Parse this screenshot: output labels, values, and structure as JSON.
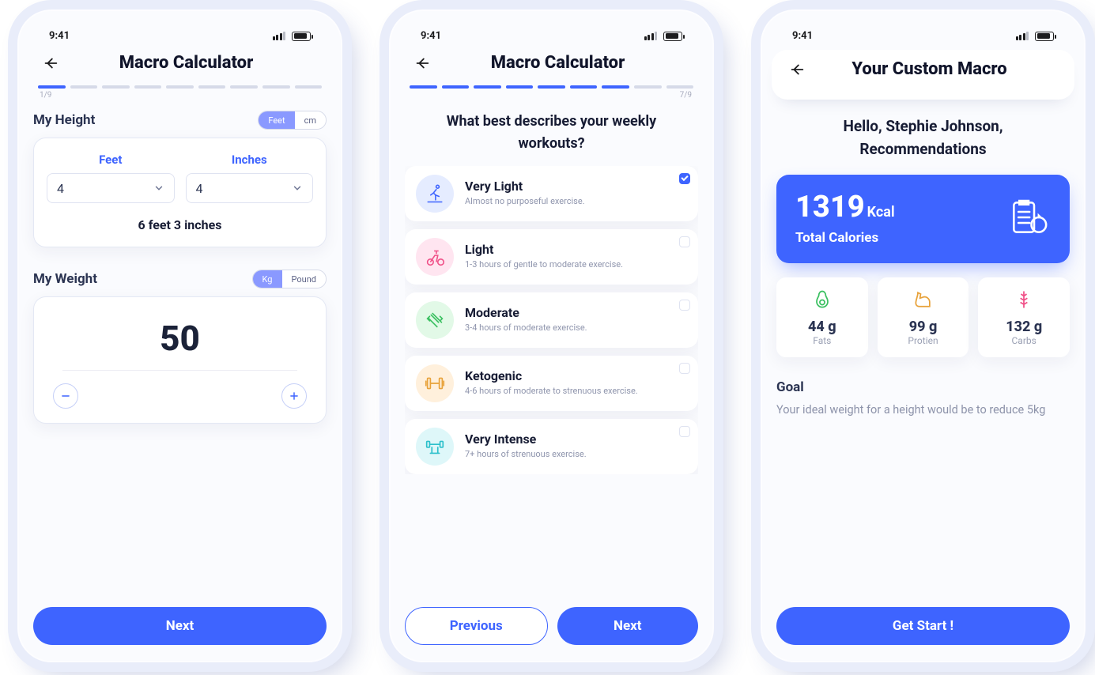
{
  "status": {
    "time": "9:41"
  },
  "screen1": {
    "title": "Macro Calculator",
    "progress": "1/9",
    "height": {
      "label": "My Height",
      "unit_feet": "Feet",
      "unit_cm": "cm",
      "col_feet": "Feet",
      "col_inches": "Inches",
      "val_feet": "4",
      "val_inches": "4",
      "summary": "6 feet 3 inches"
    },
    "weight": {
      "label": "My Weight",
      "unit_kg": "Kg",
      "unit_pound": "Pound",
      "value": "50"
    },
    "next": "Next"
  },
  "screen2": {
    "title": "Macro Calculator",
    "progress": "7/9",
    "question": "What best describes your weekly workouts?",
    "options": [
      {
        "title": "Very Light",
        "desc": "Almost no purposeful exercise.",
        "selected": true
      },
      {
        "title": "Light",
        "desc": "1-3 hours of gentle to moderate exercise."
      },
      {
        "title": "Moderate",
        "desc": "3-4 hours of moderate exercise."
      },
      {
        "title": "Ketogenic",
        "desc": "4-6 hours of moderate to strenuous exercise."
      },
      {
        "title": "Very Intense",
        "desc": "7+ hours of strenuous exercise."
      }
    ],
    "prev": "Previous",
    "next": "Next"
  },
  "screen3": {
    "title": "Your Custom Macro",
    "hello": "Hello, Stephie Johnson, Recommendations",
    "kcal_value": "1319",
    "kcal_unit": "Kcal",
    "kcal_label": "Total Calories",
    "macros": {
      "fats": {
        "value": "44 g",
        "label": "Fats"
      },
      "protein": {
        "value": "99 g",
        "label": "Protien"
      },
      "carbs": {
        "value": "132 g",
        "label": "Carbs"
      }
    },
    "goal_h": "Goal",
    "goal_t": "Your ideal weight for a height would be to reduce 5kg",
    "cta": "Get Start !"
  }
}
